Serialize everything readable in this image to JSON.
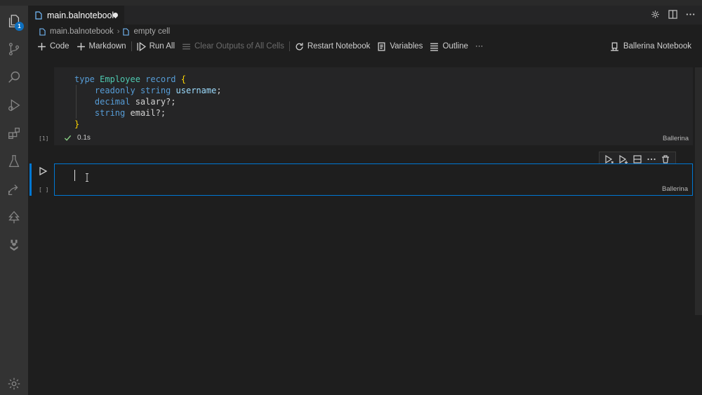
{
  "window": {
    "tab_title": "main.balnotebook"
  },
  "activity_bar": {
    "items": [
      {
        "name": "explorer",
        "icon": "files-icon",
        "badge": "1"
      },
      {
        "name": "source-control",
        "icon": "source-control-icon"
      },
      {
        "name": "search",
        "icon": "search-icon"
      },
      {
        "name": "run-debug",
        "icon": "run-debug-icon"
      },
      {
        "name": "extensions",
        "icon": "extensions-icon"
      },
      {
        "name": "testing",
        "icon": "flask-icon"
      },
      {
        "name": "remote",
        "icon": "remote-icon"
      },
      {
        "name": "tree",
        "icon": "tree-icon"
      },
      {
        "name": "ballerina",
        "icon": "ballerina-icon"
      }
    ],
    "settings_icon": "gear-icon"
  },
  "breadcrumb": {
    "file": "main.balnotebook",
    "cell": "empty cell"
  },
  "toolbar": {
    "code_label": "Code",
    "markdown_label": "Markdown",
    "run_all_label": "Run All",
    "clear_outputs_label": "Clear Outputs of All Cells",
    "restart_label": "Restart Notebook",
    "variables_label": "Variables",
    "outline_label": "Outline",
    "more_label": "···",
    "kernel_label": "Ballerina Notebook"
  },
  "cells": [
    {
      "exec_count": "[1]",
      "duration": "0.1s",
      "language": "Ballerina",
      "code_lines": [
        "type Employee record {",
        "    readonly string username;",
        "    decimal salary?;",
        "    string email?;",
        "}"
      ]
    },
    {
      "exec_count": "[ ]",
      "language": "Ballerina",
      "code_lines": []
    }
  ],
  "colors": {
    "accent": "#0078d4",
    "keyword": "#569cd6",
    "type": "#4ec9b0",
    "bracket": "#ffd700",
    "success": "#89d185"
  }
}
